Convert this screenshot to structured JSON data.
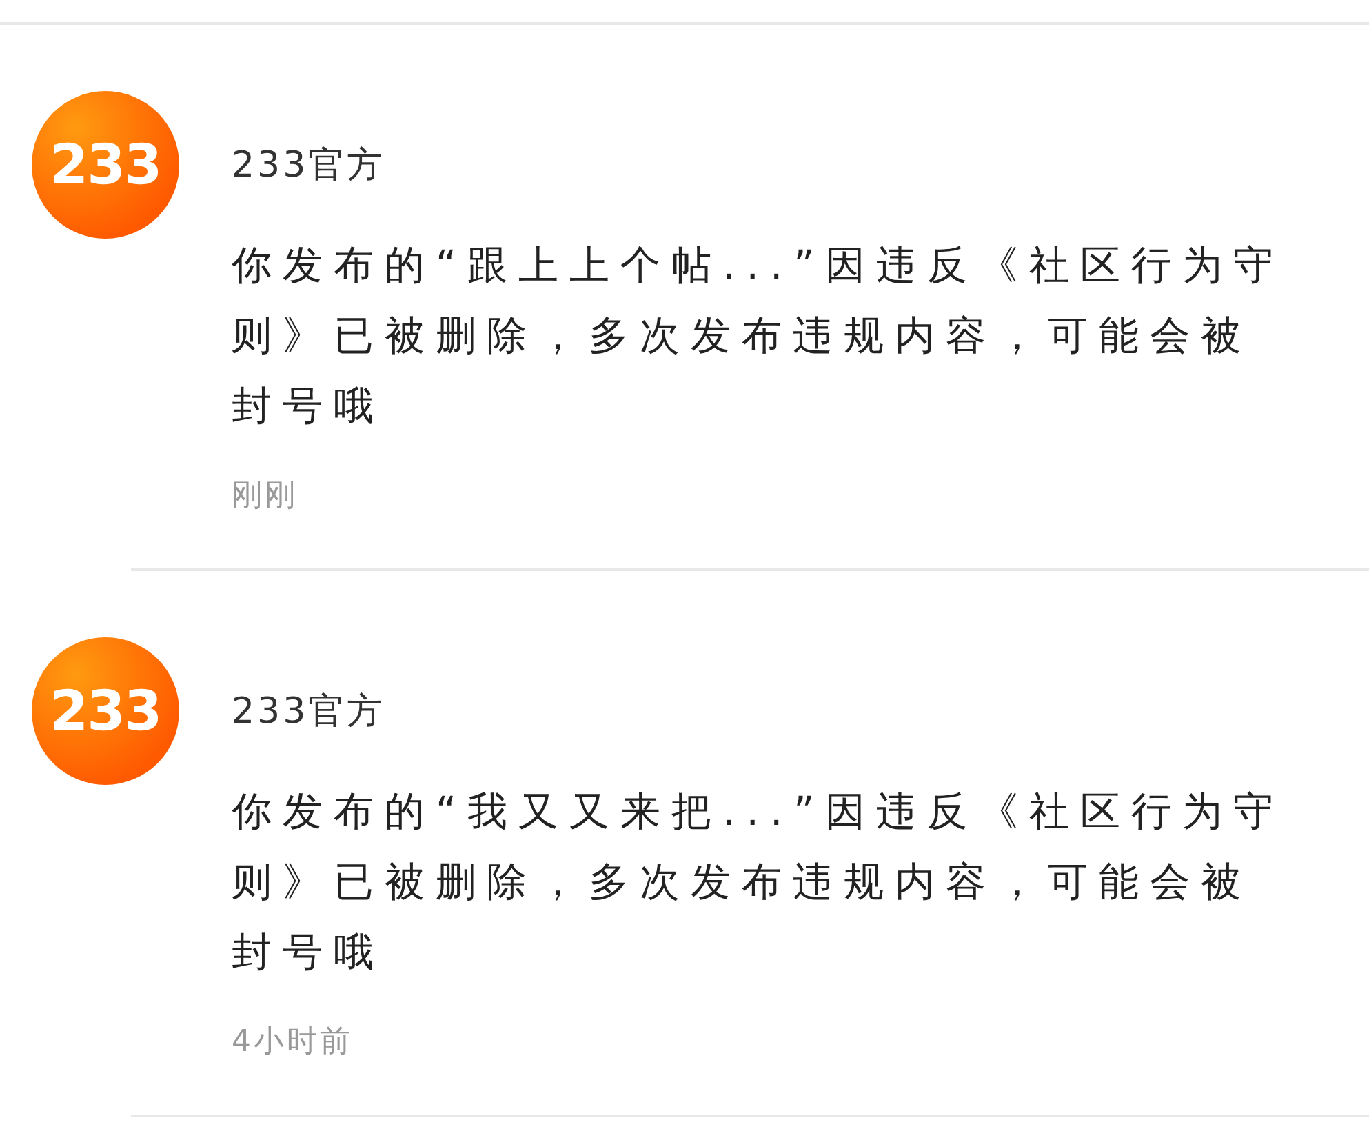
{
  "notifications": [
    {
      "avatar_text": "233",
      "sender": "233官方",
      "message": "你发布的“跟上上个帖...”因违反《社区行为守则》已被删除，多次发布违规内容，可能会被封号哦",
      "time": "刚刚"
    },
    {
      "avatar_text": "233",
      "sender": "233官方",
      "message": "你发布的“我又又来把...”因违反《社区行为守则》已被删除，多次发布违规内容，可能会被封号哦",
      "time": "4小时前"
    }
  ]
}
